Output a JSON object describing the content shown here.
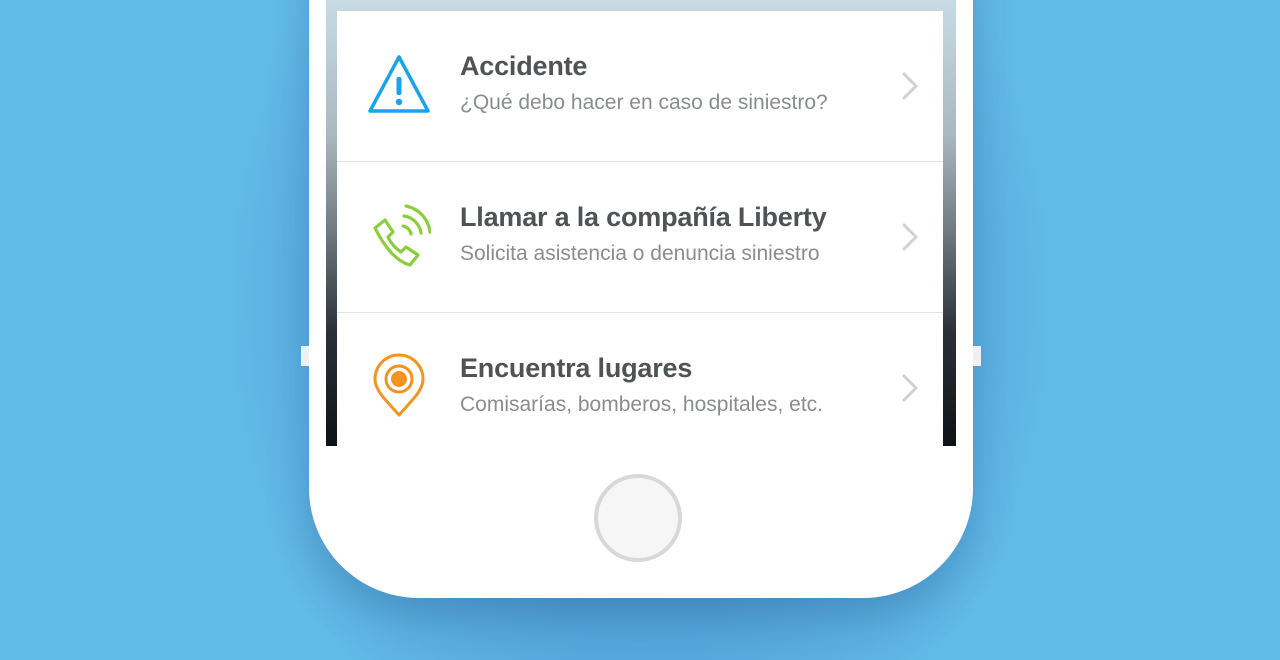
{
  "colors": {
    "background": "#62bbe8",
    "warning_blue": "#1aa3e8",
    "phone_green": "#8ccd3e",
    "location_orange": "#f39324",
    "title_text": "#505355",
    "subtitle_text": "#8a8d8f"
  },
  "menu": {
    "items": [
      {
        "title": "Accidente",
        "subtitle": "¿Qué debo hacer en caso de siniestro?",
        "icon": "warning-triangle-icon"
      },
      {
        "title": "Llamar a la compañía Liberty",
        "subtitle": "Solicita asistencia o denuncia siniestro",
        "icon": "phone-call-icon"
      },
      {
        "title": "Encuentra lugares",
        "subtitle": "Comisarías, bomberos, hospitales, etc.",
        "icon": "location-pin-icon"
      }
    ]
  }
}
